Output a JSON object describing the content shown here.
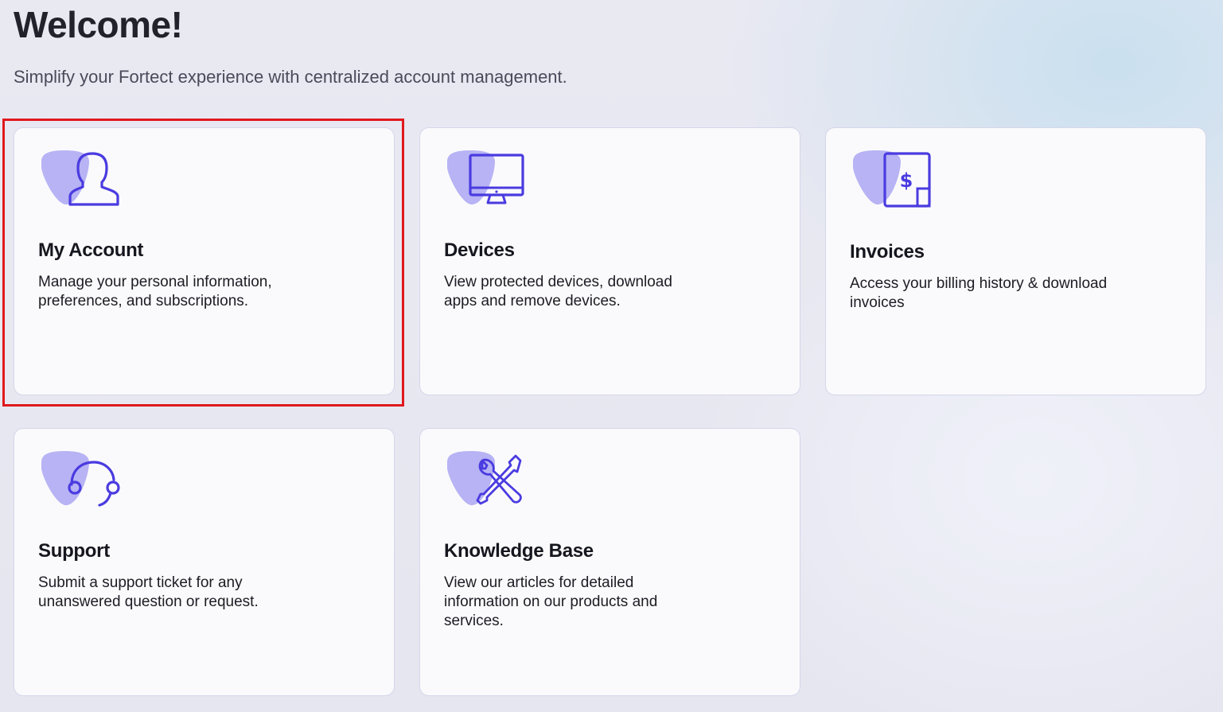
{
  "header": {
    "title": "Welcome!",
    "subtitle": "Simplify your Fortect experience with centralized account management."
  },
  "colors": {
    "accent": "#4a3be0",
    "blob": "#b7b3f4",
    "highlight": "#e0191d"
  },
  "cards": [
    {
      "icon": "user-icon",
      "title": "My Account",
      "description": "Manage your personal information, preferences, and subscriptions.",
      "highlighted": true
    },
    {
      "icon": "monitor-icon",
      "title": "Devices",
      "description": "View protected devices, download apps and remove devices."
    },
    {
      "icon": "invoice-icon",
      "title": "Invoices",
      "description": "Access your billing history & download invoices"
    },
    {
      "icon": "headset-icon",
      "title": "Support",
      "description": "Submit a support ticket for any unanswered question or request."
    },
    {
      "icon": "tools-icon",
      "title": "Knowledge Base",
      "description": "View our articles for detailed information on our products and services."
    }
  ]
}
